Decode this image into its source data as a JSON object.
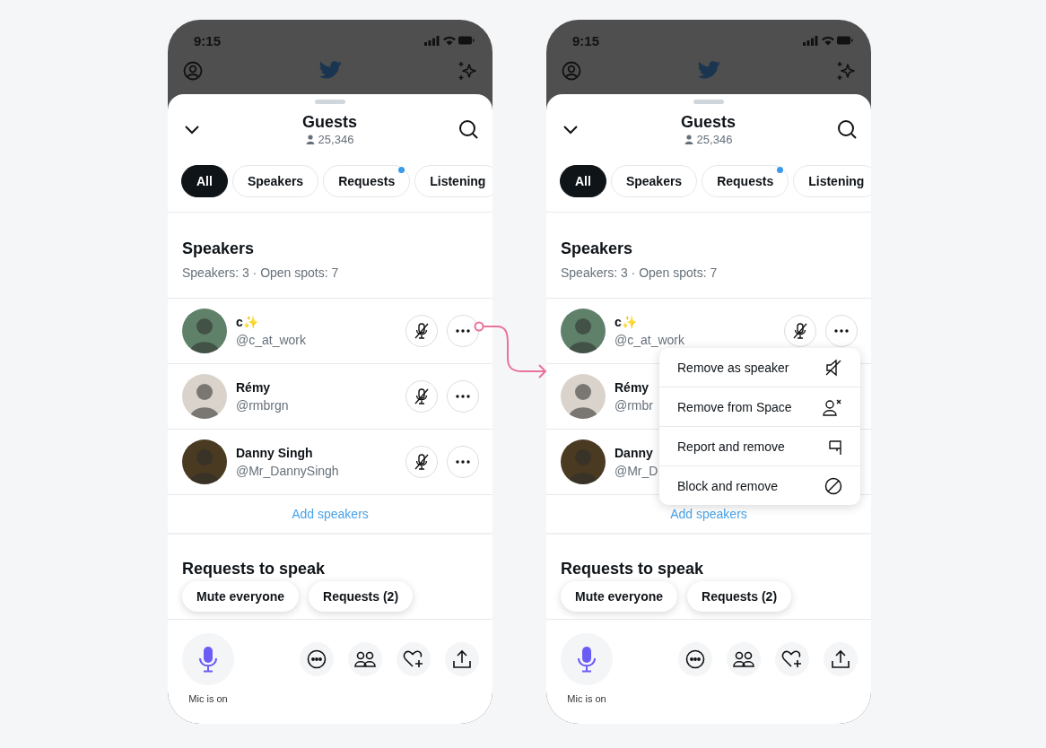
{
  "phones": [
    {
      "time": "9:15",
      "title": "Guests",
      "count": "25,346",
      "tabs": [
        {
          "label": "All",
          "selected": true,
          "badge": false
        },
        {
          "label": "Speakers",
          "selected": false,
          "badge": false
        },
        {
          "label": "Requests",
          "selected": false,
          "badge": true
        },
        {
          "label": "Listening",
          "selected": false,
          "badge": false
        }
      ],
      "section_title": "Speakers",
      "section_subtitle": "Speakers: 3 · Open spots: 7",
      "speakers": [
        {
          "name": "c✨",
          "handle": "@c_at_work",
          "color": "#5f8069",
          "muted": true
        },
        {
          "name": "Rémy",
          "handle": "@rmbrgn",
          "color": "#d9d3cb",
          "muted": true
        },
        {
          "name": "Danny Singh",
          "handle": "@Mr_DannySingh",
          "color": "#4a3a22",
          "muted": true
        }
      ],
      "add_label": "Add speakers",
      "requests_title": "Requests to speak",
      "actions": [
        "Mute everyone",
        "Requests (2)"
      ],
      "mic": {
        "label": "Mic is on",
        "on": true
      }
    },
    {
      "time": "9:15",
      "title": "Guests",
      "count": "25,346",
      "tabs": [
        {
          "label": "All",
          "selected": true,
          "badge": false
        },
        {
          "label": "Speakers",
          "selected": false,
          "badge": false
        },
        {
          "label": "Requests",
          "selected": false,
          "badge": true
        },
        {
          "label": "Listening",
          "selected": false,
          "badge": false
        }
      ],
      "section_title": "Speakers",
      "section_subtitle": "Speakers: 3 · Open spots: 7",
      "speakers": [
        {
          "name": "c✨",
          "handle": "@c_at_work",
          "color": "#5f8069",
          "muted": true
        },
        {
          "name": "Rémy",
          "handle": "@rmbr",
          "color": "#d9d3cb"
        },
        {
          "name": "Danny",
          "handle": "@Mr_D",
          "color": "#4a3a22"
        }
      ],
      "add_label": "Add speakers",
      "requests_title": "Requests to speak",
      "actions": [
        "Mute everyone",
        "Requests (2)"
      ],
      "mic": {
        "label": "Mic is on",
        "on": true
      },
      "menu": [
        {
          "label": "Remove as speaker",
          "kind": "speaker-off"
        },
        {
          "label": "Remove from Space",
          "kind": "person-remove"
        },
        {
          "label": "Report and remove",
          "kind": "flag"
        },
        {
          "label": "Block and remove",
          "kind": "block"
        }
      ]
    }
  ]
}
